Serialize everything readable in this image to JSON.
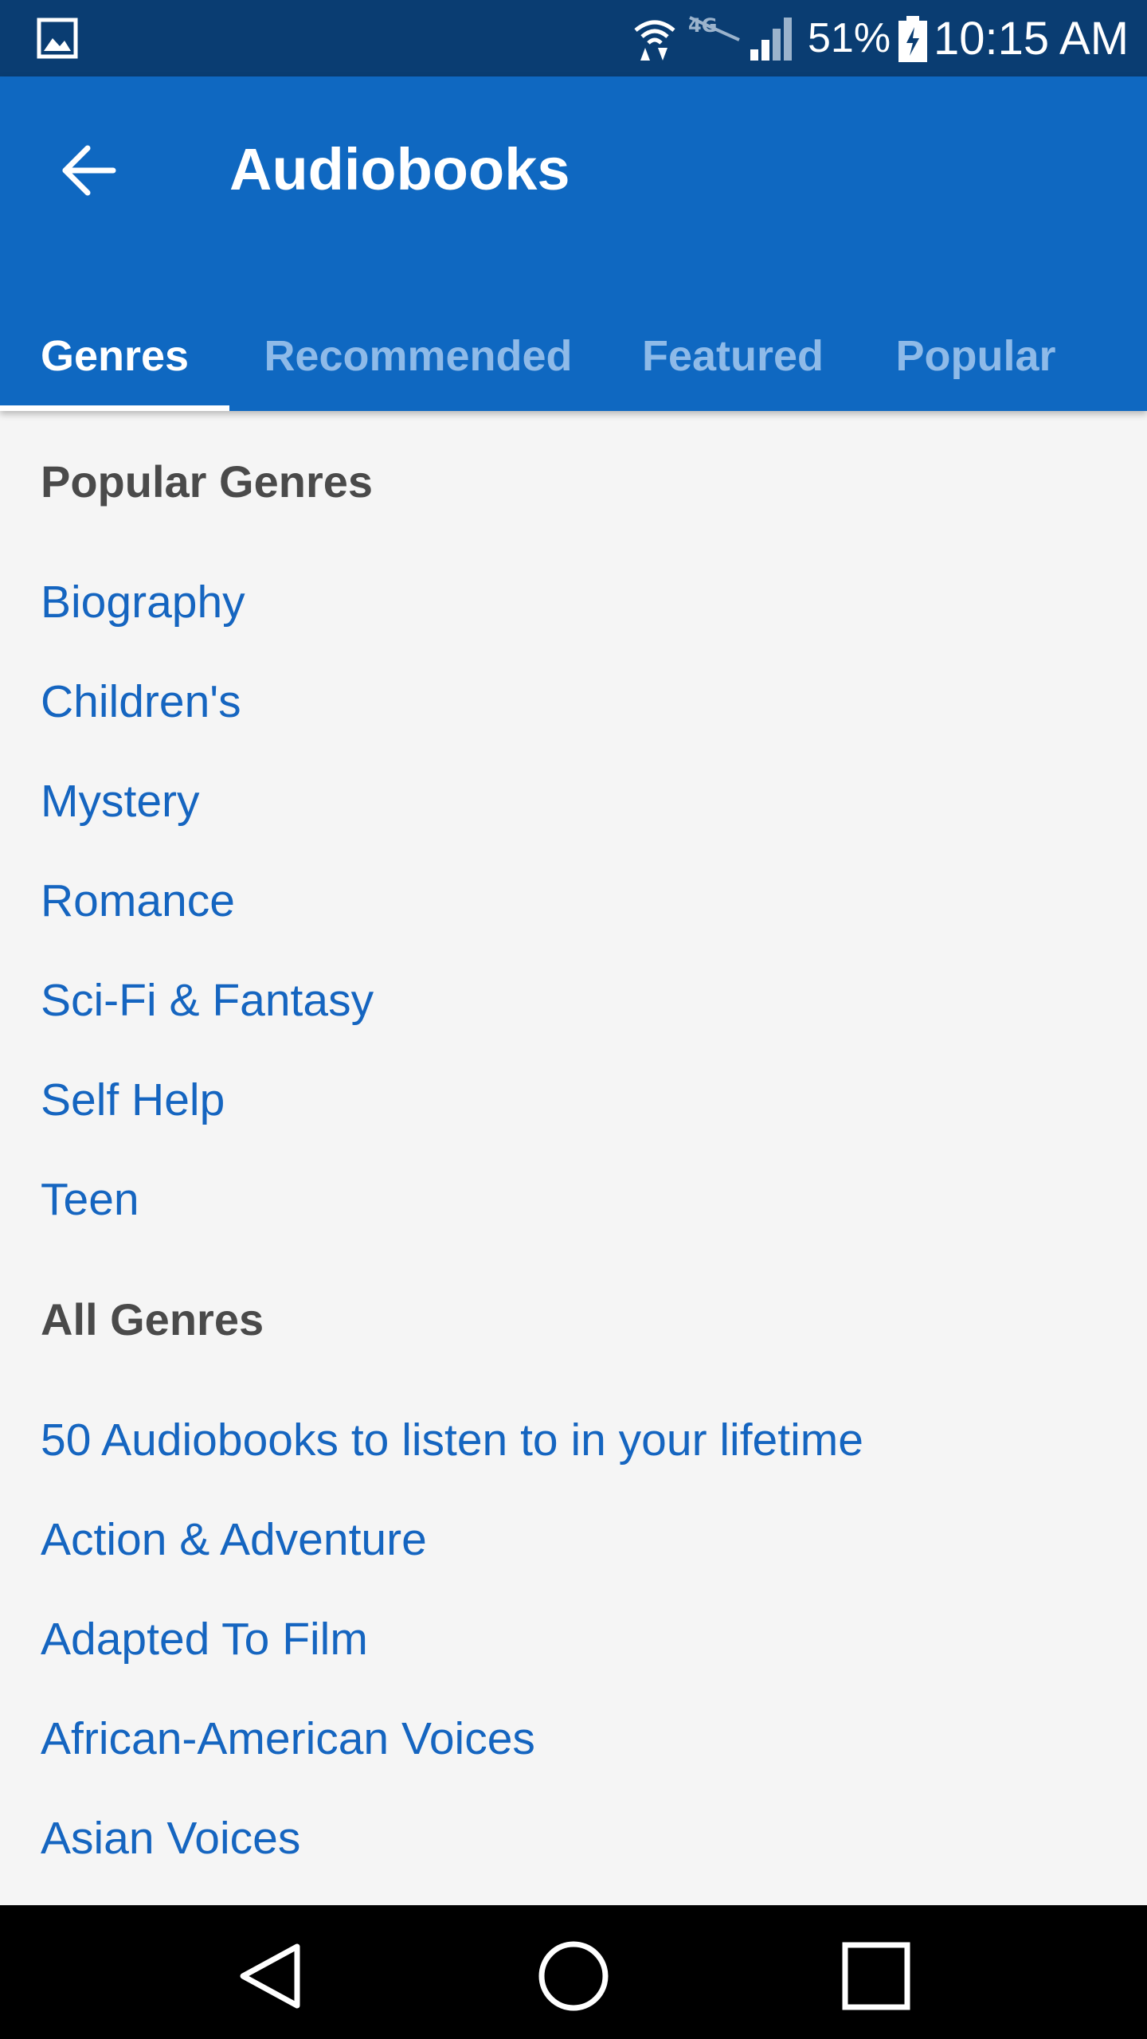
{
  "status_bar": {
    "battery_percent": "51%",
    "time": "10:15 AM",
    "icons": [
      "gallery-icon",
      "wifi-icon",
      "lte-icon",
      "signal-icon",
      "battery-charging-icon"
    ]
  },
  "app_bar": {
    "title": "Audiobooks",
    "back_icon": "arrow-left-icon",
    "background_color": "#0f68c1"
  },
  "tabs": [
    {
      "label": "Genres",
      "active": true
    },
    {
      "label": "Recommended",
      "active": false
    },
    {
      "label": "Featured",
      "active": false
    },
    {
      "label": "Popular",
      "active": false
    }
  ],
  "sections": {
    "popular": {
      "heading": "Popular Genres",
      "items": [
        "Biography",
        "Children's",
        "Mystery",
        "Romance",
        "Sci-Fi & Fantasy",
        "Self Help",
        "Teen"
      ]
    },
    "all": {
      "heading": "All Genres",
      "items": [
        "50 Audiobooks to listen to in your lifetime",
        "Action & Adventure",
        "Adapted To Film",
        "African-American Voices",
        "Asian Voices"
      ]
    }
  },
  "nav_bar": {
    "icons": [
      "back-triangle-icon",
      "home-circle-icon",
      "recents-square-icon"
    ]
  },
  "colors": {
    "link": "#1565c0",
    "heading": "#4a4a4a",
    "status_bar": "#0a3d72",
    "tab_inactive": "#8ebae8"
  }
}
